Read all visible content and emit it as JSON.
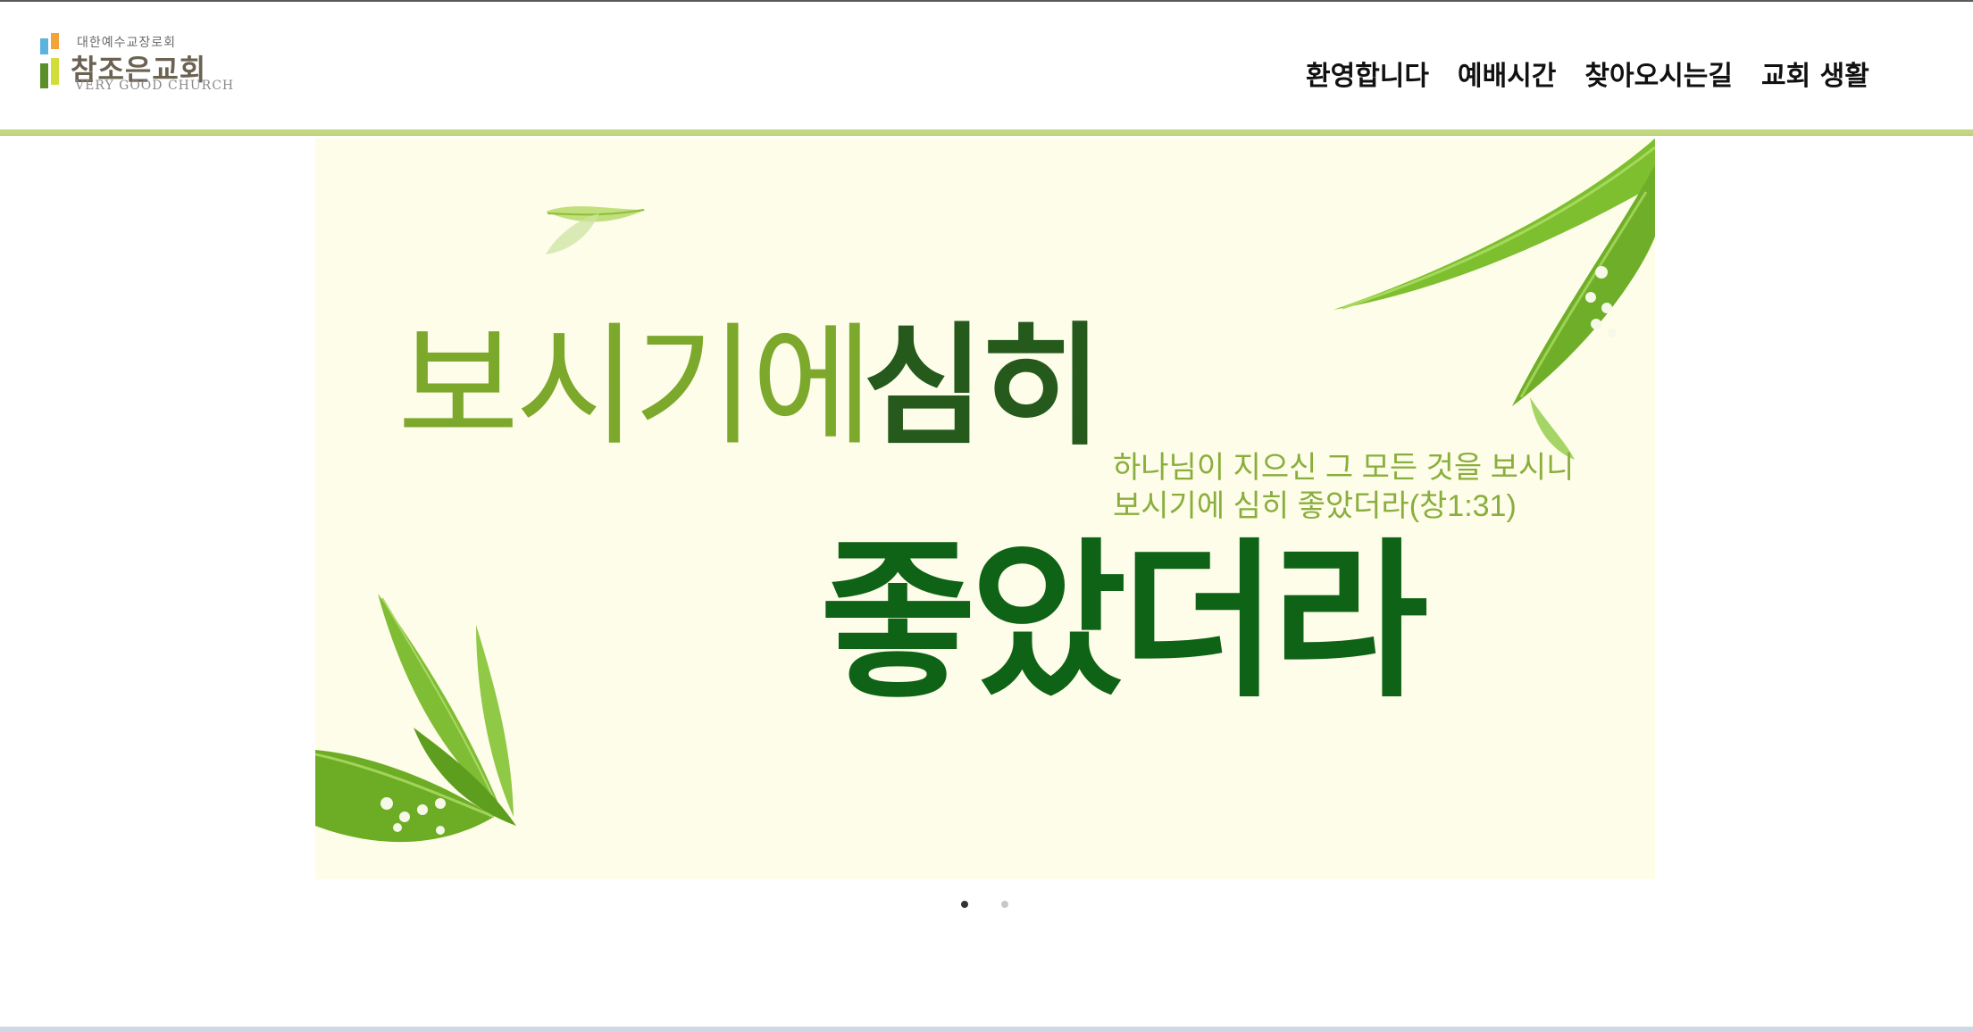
{
  "header": {
    "logo": {
      "denomination": "대한예수교장로회",
      "name": "참조은교회",
      "english": "VERY GOOD CHURCH"
    },
    "nav": [
      "환영합니다",
      "예배시간",
      "찾아오시는길",
      "교회 생활"
    ]
  },
  "hero": {
    "headline_light": "보시기에",
    "headline_dark": "심히",
    "verse_line1": "하나님이 지으신 그 모든 것을 보시니",
    "verse_line2": "보시기에 심히 좋았더라(창1:31)",
    "headline_big": "좋았더라"
  },
  "carousel": {
    "slide_count": 2,
    "active_index": 0
  },
  "colors": {
    "header_rule": "#c2d77f",
    "banner_bg": "#fefde9",
    "headline_light": "#7ca82c",
    "headline_dark": "#255a1c",
    "headline_big": "#0f6316",
    "verse": "#8aae3e",
    "dot_active": "#333333",
    "dot_inactive": "#c8c8c8"
  },
  "icons": {
    "logo_mark": "church-logo-icon",
    "decor": "leaf-icon"
  }
}
